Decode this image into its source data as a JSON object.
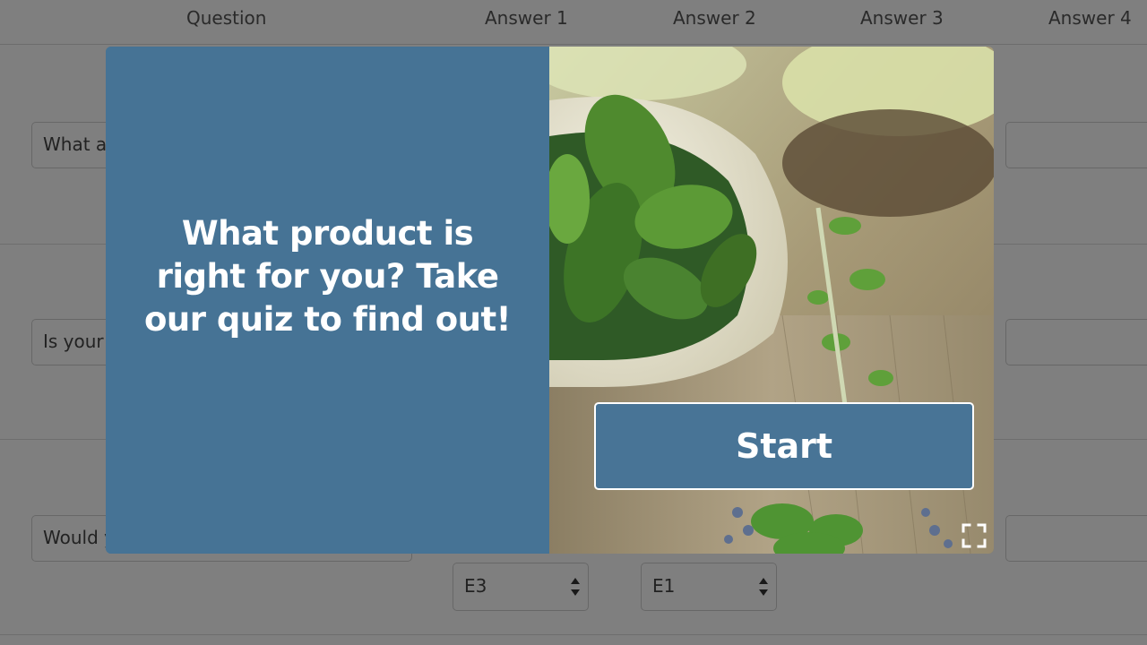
{
  "header": {
    "columns": [
      "Question",
      "Answer 1",
      "Answer 2",
      "Answer 3",
      "Answer 4"
    ]
  },
  "rows": [
    {
      "question": "What a"
    },
    {
      "question": "Is your"
    },
    {
      "question": "Would y"
    }
  ],
  "selects": {
    "answer1": "E3",
    "answer2": "E1"
  },
  "modal": {
    "title": "What product is right for you? Take our quiz to find out!",
    "start_label": "Start"
  },
  "colors": {
    "panel": "#467395",
    "button": "#487496",
    "overlay": "rgba(0,0,0,0.5)"
  },
  "icons": {
    "fullscreen": "fullscreen-icon"
  }
}
